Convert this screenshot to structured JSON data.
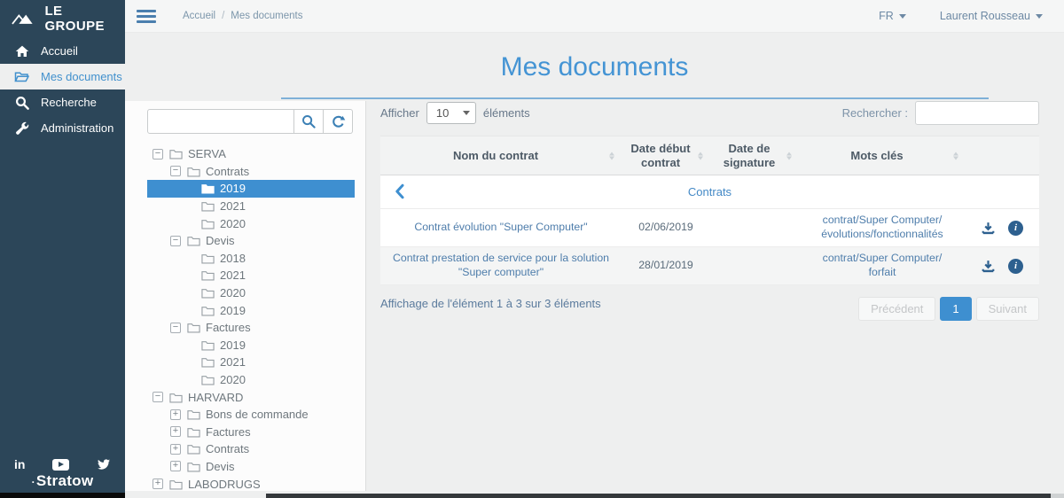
{
  "colors": {
    "sidebar": "#2c4659",
    "accent": "#3e8fd0",
    "title_blue": "#4494d4"
  },
  "sidebar": {
    "logo": "LE GROUPE",
    "items": [
      {
        "label": "Accueil",
        "icon": "home-icon",
        "active": false
      },
      {
        "label": "Mes documents",
        "icon": "folder-open-icon",
        "active": true
      },
      {
        "label": "Recherche",
        "icon": "search-icon",
        "active": false
      },
      {
        "label": "Administration",
        "icon": "wrench-icon",
        "active": false
      }
    ],
    "footer_logo": "Stratow"
  },
  "topbar": {
    "breadcrumb": [
      "Accueil",
      "Mes documents"
    ],
    "breadcrumb_separator": "/",
    "language": "FR",
    "user": "Laurent Rousseau"
  },
  "page": {
    "title": "Mes documents"
  },
  "tree": {
    "nodes": [
      {
        "label": "SERVA",
        "depth": 0,
        "expander": "minus"
      },
      {
        "label": "Contrats",
        "depth": 1,
        "expander": "minus"
      },
      {
        "label": "2019",
        "depth": 2,
        "expander": "none",
        "selected": true
      },
      {
        "label": "2021",
        "depth": 2,
        "expander": "none"
      },
      {
        "label": "2020",
        "depth": 2,
        "expander": "none"
      },
      {
        "label": "Devis",
        "depth": 1,
        "expander": "minus"
      },
      {
        "label": "2018",
        "depth": 2,
        "expander": "none"
      },
      {
        "label": "2021",
        "depth": 2,
        "expander": "none"
      },
      {
        "label": "2020",
        "depth": 2,
        "expander": "none"
      },
      {
        "label": "2019",
        "depth": 2,
        "expander": "none"
      },
      {
        "label": "Factures",
        "depth": 1,
        "expander": "minus"
      },
      {
        "label": "2019",
        "depth": 2,
        "expander": "none"
      },
      {
        "label": "2021",
        "depth": 2,
        "expander": "none"
      },
      {
        "label": "2020",
        "depth": 2,
        "expander": "none"
      },
      {
        "label": "HARVARD",
        "depth": 0,
        "expander": "minus"
      },
      {
        "label": "Bons de commande",
        "depth": 1,
        "expander": "plus"
      },
      {
        "label": "Factures",
        "depth": 1,
        "expander": "plus"
      },
      {
        "label": "Contrats",
        "depth": 1,
        "expander": "plus"
      },
      {
        "label": "Devis",
        "depth": 1,
        "expander": "plus"
      },
      {
        "label": "LABODRUGS",
        "depth": 0,
        "expander": "plus"
      }
    ]
  },
  "table": {
    "length_label_before": "Afficher",
    "length_value": "10",
    "length_label_after": "éléments",
    "search_label": "Rechercher :",
    "headers": [
      "Nom du contrat",
      "Date début contrat",
      "Date de signature",
      "Mots clés"
    ],
    "group_row": {
      "label": "Contrats"
    },
    "rows": [
      {
        "name": "Contrat évolution \"Super Computer\"",
        "date_debut": "02/06/2019",
        "date_signature": "",
        "keywords": "contrat/Super Computer/évolutions/fonctionnalités"
      },
      {
        "name": "Contrat prestation de service pour la solution \"Super computer\"",
        "date_debut": "28/01/2019",
        "date_signature": "",
        "keywords": "contrat/Super Computer/forfait"
      }
    ],
    "info": "Affichage de l'élément 1 à 3 sur 3 éléments",
    "pagination": {
      "previous": "Précédent",
      "page": "1",
      "next": "Suivant"
    }
  },
  "icons": {
    "linkedin_text": "in",
    "info_text": "i"
  }
}
